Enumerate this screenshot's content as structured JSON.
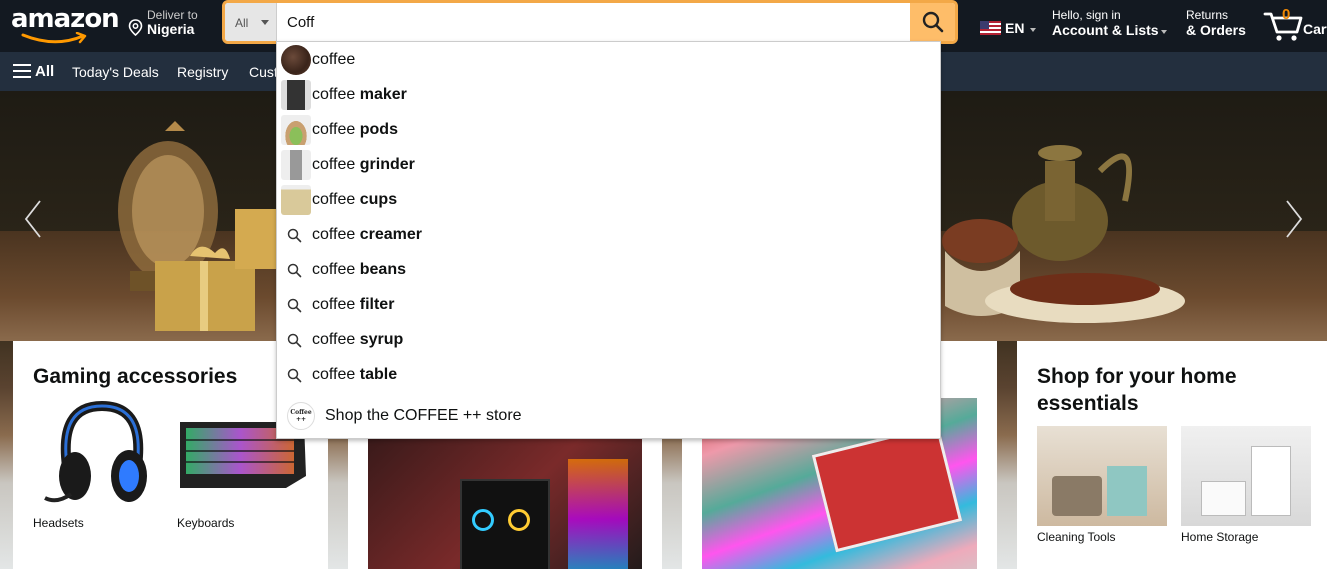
{
  "header": {
    "logo_text": "amazon",
    "deliver_label": "Deliver to",
    "deliver_location": "Nigeria",
    "search": {
      "category": "All",
      "value": "Coff"
    },
    "language": "EN",
    "account_line1": "Hello, sign in",
    "account_line2": "Account & Lists",
    "returns_line1": "Returns",
    "returns_line2": "& Orders",
    "cart_count": "0",
    "cart_label": "Cart"
  },
  "subnav": {
    "all_label": "All",
    "items": [
      "Today's Deals",
      "Registry",
      "Cust"
    ]
  },
  "suggestions": {
    "prefix": "coffee",
    "items": [
      {
        "prefix": "coffee",
        "suffix": "",
        "icon": "product-thumbnail-coffee-beans"
      },
      {
        "prefix": "coffee",
        "suffix": " maker",
        "icon": "product-thumbnail-coffee-maker"
      },
      {
        "prefix": "coffee",
        "suffix": " pods",
        "icon": "product-thumbnail-coffee-pods"
      },
      {
        "prefix": "coffee",
        "suffix": " grinder",
        "icon": "product-thumbnail-coffee-grinder"
      },
      {
        "prefix": "coffee",
        "suffix": " cups",
        "icon": "product-thumbnail-coffee-cups"
      },
      {
        "prefix": "coffee",
        "suffix": " creamer",
        "icon": "search-icon"
      },
      {
        "prefix": "coffee",
        "suffix": " beans",
        "icon": "search-icon"
      },
      {
        "prefix": "coffee",
        "suffix": " filter",
        "icon": "search-icon"
      },
      {
        "prefix": "coffee",
        "suffix": " syrup",
        "icon": "search-icon"
      },
      {
        "prefix": "coffee",
        "suffix": " table",
        "icon": "search-icon"
      }
    ],
    "store_label": "Shop the COFFEE ++ store",
    "store_logo_text": "Coffee ++"
  },
  "cards": {
    "gaming": {
      "title": "Gaming accessories",
      "items": [
        "Headsets",
        "Keyboards"
      ]
    },
    "home": {
      "title": "Shop for your home essentials",
      "items": [
        "Cleaning Tools",
        "Home Storage"
      ]
    }
  },
  "colors": {
    "nav_bg": "#131921",
    "subnav_bg": "#232f3e",
    "search_button": "#febd69",
    "search_border": "#f3a847",
    "cart_count": "#f08804"
  }
}
